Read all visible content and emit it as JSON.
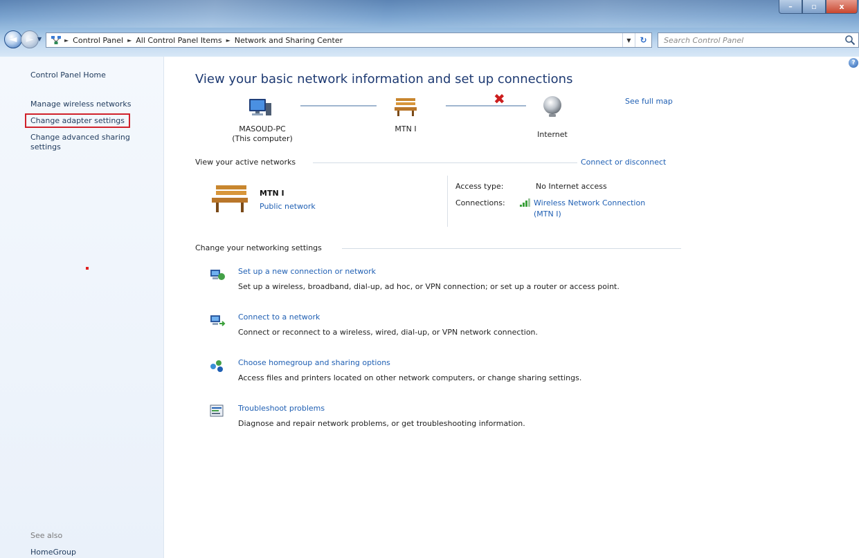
{
  "window": {
    "buttons": {
      "minimize": "–",
      "maximize": "▫",
      "close": "x"
    }
  },
  "address_bar": {
    "breadcrumbs": [
      "Control Panel",
      "All Control Panel Items",
      "Network and Sharing Center"
    ]
  },
  "search": {
    "placeholder": "Search Control Panel"
  },
  "left_pane": {
    "home": "Control Panel Home",
    "links": [
      "Manage wireless networks",
      "Change adapter settings",
      "Change advanced sharing",
      "settings"
    ],
    "see_also": "See also",
    "see_also_items": [
      "HomeGroup"
    ]
  },
  "main": {
    "title": "View your basic network information and set up connections",
    "see_full_map": "See full map",
    "map": {
      "computer_name": "MASOUD-PC",
      "computer_sub": "(This computer)",
      "network": "MTN I",
      "internet": "Internet"
    },
    "active_networks": {
      "title": "View your active networks",
      "connect_link": "Connect or disconnect",
      "network_name": "MTN I",
      "network_type": "Public network",
      "access_type_label": "Access type:",
      "access_type_value": "No Internet access",
      "connections_label": "Connections:",
      "connection_link_line1": "Wireless Network Connection",
      "connection_link_line2": "(MTN I)"
    },
    "settings": {
      "title": "Change your networking settings",
      "tasks": [
        {
          "link": "Set up a new connection or network",
          "desc": "Set up a wireless, broadband, dial-up, ad hoc, or VPN connection; or set up a router or access point."
        },
        {
          "link": "Connect to a network",
          "desc": "Connect or reconnect to a wireless, wired, dial-up, or VPN network connection."
        },
        {
          "link": "Choose homegroup and sharing options",
          "desc": "Access files and printers located on other network computers, or change sharing settings."
        },
        {
          "link": "Troubleshoot problems",
          "desc": "Diagnose and repair network problems, or get troubleshooting information."
        }
      ]
    }
  }
}
